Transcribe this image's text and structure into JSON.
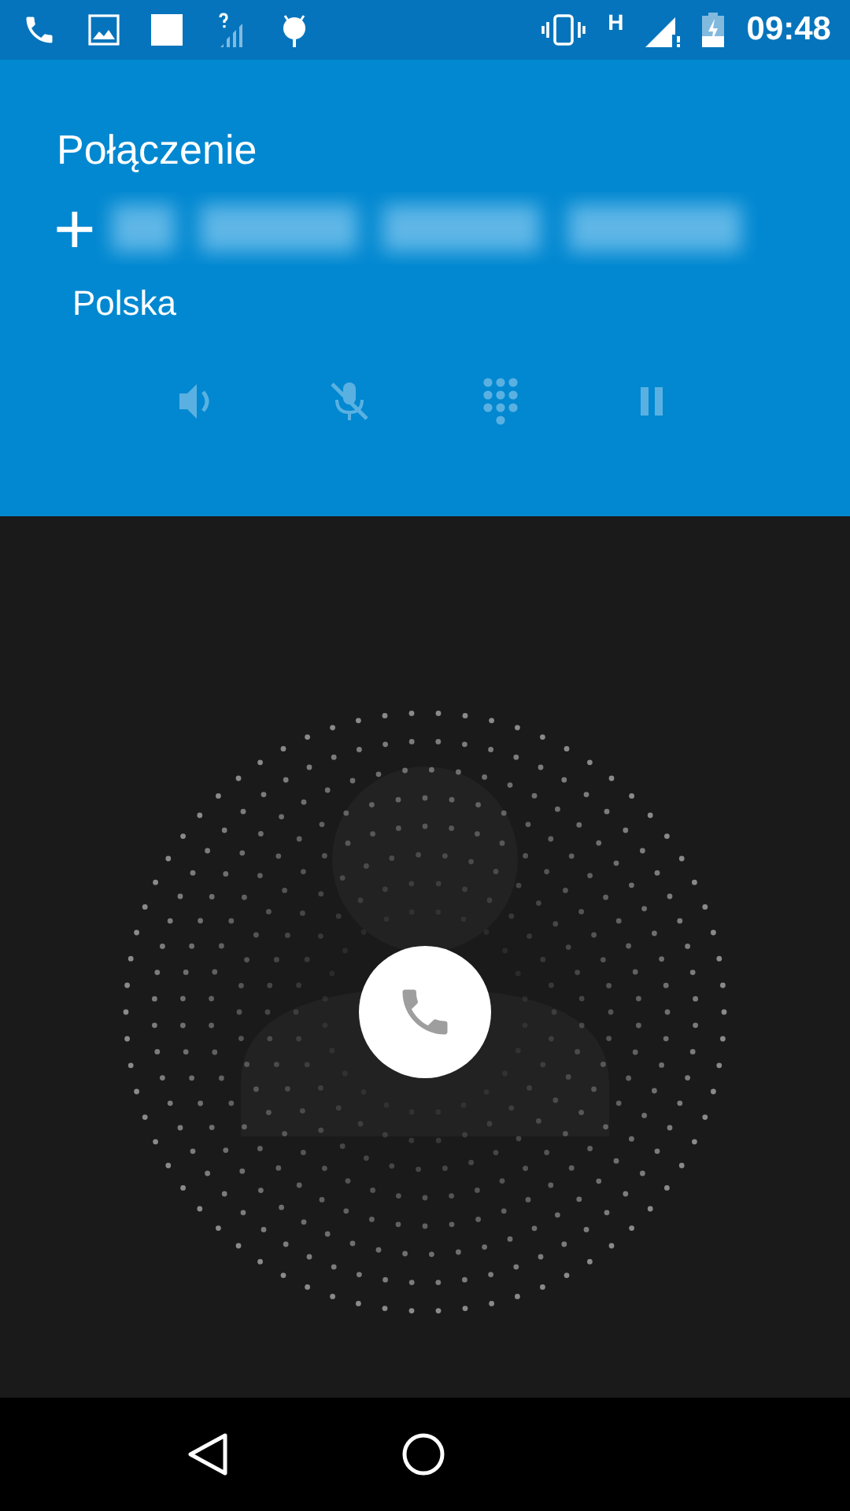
{
  "status_bar": {
    "network_type": "H",
    "time": "09:48"
  },
  "call": {
    "label": "Połączenie",
    "number_prefix": "+",
    "location": "Polska"
  },
  "call_controls": [
    {
      "kind": "speaker",
      "disabled": true
    },
    {
      "kind": "mute",
      "disabled": true
    },
    {
      "kind": "dialpad",
      "disabled": true
    },
    {
      "kind": "hold",
      "disabled": true
    }
  ]
}
